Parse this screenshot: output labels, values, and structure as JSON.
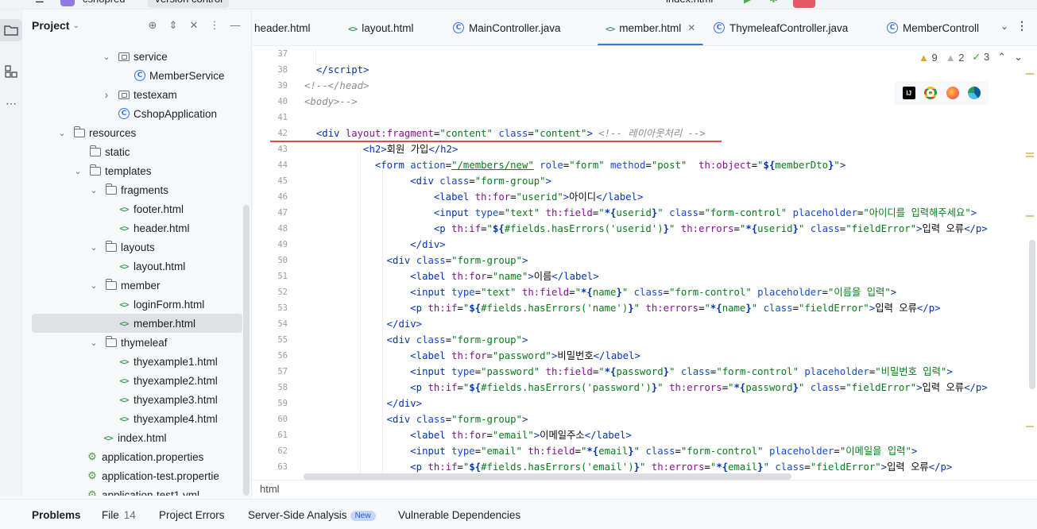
{
  "top": {
    "project_name": "cshopred",
    "vcs_label": "Version control",
    "run_config": "index.html"
  },
  "toolstrip": {
    "items": [
      "project-icon",
      "structure-icon",
      "more-icon"
    ]
  },
  "project_panel": {
    "title": "Project",
    "tree": [
      {
        "label": "service",
        "type": "package",
        "expanded": true
      },
      {
        "label": "MemberService",
        "type": "class"
      },
      {
        "label": "testexam",
        "type": "package",
        "expanded": false
      },
      {
        "label": "CshopApplication",
        "type": "class"
      },
      {
        "label": "resources",
        "type": "folder",
        "expanded": true
      },
      {
        "label": "static",
        "type": "folder"
      },
      {
        "label": "templates",
        "type": "folder",
        "expanded": true
      },
      {
        "label": "fragments",
        "type": "folder",
        "expanded": true
      },
      {
        "label": "footer.html",
        "type": "html"
      },
      {
        "label": "header.html",
        "type": "html"
      },
      {
        "label": "layouts",
        "type": "folder",
        "expanded": true
      },
      {
        "label": "layout.html",
        "type": "html"
      },
      {
        "label": "member",
        "type": "folder",
        "expanded": true
      },
      {
        "label": "loginForm.html",
        "type": "html"
      },
      {
        "label": "member.html",
        "type": "html",
        "selected": true
      },
      {
        "label": "thymeleaf",
        "type": "folder",
        "expanded": true
      },
      {
        "label": "thyexample1.html",
        "type": "html"
      },
      {
        "label": "thyexample2.html",
        "type": "html"
      },
      {
        "label": "thyexample3.html",
        "type": "html"
      },
      {
        "label": "thyexample4.html",
        "type": "html"
      },
      {
        "label": "index.html",
        "type": "html"
      },
      {
        "label": "application.properties",
        "type": "properties"
      },
      {
        "label": "application-test.propertie",
        "type": "properties"
      },
      {
        "label": "application-test1.yml",
        "type": "properties"
      }
    ]
  },
  "tabs": [
    {
      "label": "header.html",
      "type": "html"
    },
    {
      "label": "layout.html",
      "type": "html"
    },
    {
      "label": "MainController.java",
      "type": "class"
    },
    {
      "label": "member.html",
      "type": "html",
      "active": true
    },
    {
      "label": "ThymeleafController.java",
      "type": "class"
    },
    {
      "label": "MemberControll",
      "type": "class"
    }
  ],
  "inspections": {
    "warnings": "9",
    "weak_warnings": "2",
    "ok": "3"
  },
  "editor": {
    "line_numbers": [
      "37",
      "38",
      "39",
      "40",
      "41",
      "42",
      "43",
      "44",
      "45",
      "46",
      "47",
      "48",
      "49",
      "50",
      "51",
      "52",
      "53",
      "54",
      "55",
      "56",
      "57",
      "58",
      "59",
      "60",
      "61",
      "62",
      "63"
    ]
  },
  "breadcrumb": "html",
  "bottom_tabs": [
    {
      "label": "Problems",
      "active": true
    },
    {
      "label": "File",
      "count": "14"
    },
    {
      "label": "Project Errors"
    },
    {
      "label": "Server-Side Analysis",
      "badge": "New"
    },
    {
      "label": "Vulnerable Dependencies"
    }
  ],
  "colors": {
    "accent": "#3574f0",
    "error_underline": "#e04a4a",
    "warning": "#e0a12e"
  }
}
